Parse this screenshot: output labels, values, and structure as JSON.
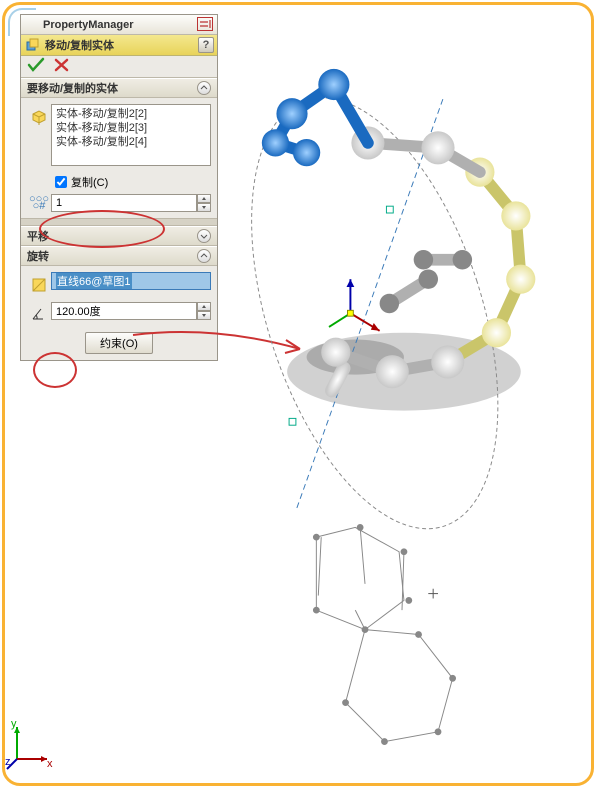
{
  "pm": {
    "title": "PropertyManager"
  },
  "feature": {
    "title": "移动/复制实体",
    "help": "?"
  },
  "sections": {
    "bodies": {
      "title": "要移动/复制的实体",
      "items": [
        "实体-移动/复制2[2]",
        "实体-移动/复制2[3]",
        "实体-移动/复制2[4]"
      ],
      "copy_label": "复制(C)",
      "copy_checked": true,
      "count": "1"
    },
    "translate": {
      "title": "平移"
    },
    "rotate": {
      "title": "旋转",
      "axis": "直线66@草图1",
      "angle": "120.00度"
    }
  },
  "constrain_btn": "约束(O)",
  "triad": {
    "x": "x",
    "y": "y",
    "z": "z"
  }
}
